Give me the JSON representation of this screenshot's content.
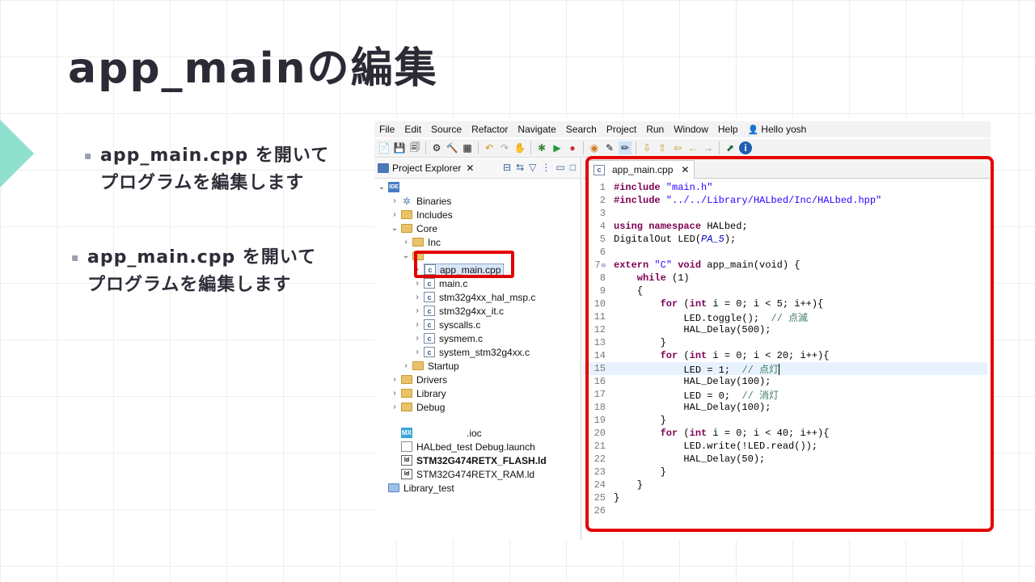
{
  "slide": {
    "title": "app_mainの編集",
    "bullets": [
      {
        "line1": "app_main.cpp を開いて",
        "line2": "プログラムを編集します"
      },
      {
        "line1": "app_main.cpp を開いて",
        "line2": "プログラムを編集します"
      }
    ],
    "accent_color": "#8fe0cc",
    "highlight_color": "#e30000"
  },
  "ide": {
    "menu": [
      "File",
      "Edit",
      "Source",
      "Refactor",
      "Navigate",
      "Search",
      "Project",
      "Run",
      "Window",
      "Help"
    ],
    "user": "Hello yosh",
    "explorer": {
      "title": "Project Explorer",
      "close": "✕",
      "tree": [
        {
          "label": "",
          "icon": "project-icon",
          "expanded": true
        },
        {
          "label": "Binaries",
          "icon": "binaries-icon"
        },
        {
          "label": "Includes",
          "icon": "includes-icon"
        },
        {
          "label": "Core",
          "icon": "folder-icon",
          "expanded": true
        },
        {
          "label": "Inc",
          "icon": "folder-icon"
        },
        {
          "label": "",
          "icon": "folder-icon",
          "expanded": true
        },
        {
          "label": "app_main.cpp",
          "icon": "c-file-icon",
          "selected": true
        },
        {
          "label": "main.c",
          "icon": "c-file-icon"
        },
        {
          "label": "stm32g4xx_hal_msp.c",
          "icon": "c-file-icon"
        },
        {
          "label": "stm32g4xx_it.c",
          "icon": "c-file-icon"
        },
        {
          "label": "syscalls.c",
          "icon": "c-file-icon"
        },
        {
          "label": "sysmem.c",
          "icon": "c-file-icon"
        },
        {
          "label": "system_stm32g4xx.c",
          "icon": "c-file-icon"
        },
        {
          "label": "Startup",
          "icon": "folder-icon"
        },
        {
          "label": "Drivers",
          "icon": "folder-icon"
        },
        {
          "label": "Library",
          "icon": "folder-icon"
        },
        {
          "label": "Debug",
          "icon": "folder-icon"
        },
        {
          "label": ".ioc",
          "icon": "mx-icon"
        },
        {
          "label": "HALbed_test Debug.launch",
          "icon": "launch-file-icon"
        },
        {
          "label": "STM32G474RETX_FLASH.ld",
          "icon": "linker-file-icon",
          "bold": true
        },
        {
          "label": "STM32G474RETX_RAM.ld",
          "icon": "linker-file-icon"
        },
        {
          "label": "Library_test",
          "icon": "project-folder-icon"
        }
      ]
    },
    "editor": {
      "tab": "app_main.cpp",
      "tab_close": "✕",
      "lines": [
        "1",
        "2",
        "3",
        "4",
        "5",
        "6",
        "7",
        "8",
        "9",
        "10",
        "11",
        "12",
        "13",
        "14",
        "15",
        "16",
        "17",
        "18",
        "19",
        "20",
        "21",
        "22",
        "23",
        "24",
        "25",
        "26"
      ],
      "code": {
        "l1": {
          "a": "#include",
          "b": " \"main.h\""
        },
        "l2": {
          "a": "#include",
          "b": " \"../../Library/HALbed/Inc/HALbed.hpp\""
        },
        "l4": {
          "a": "using namespace",
          "b": " HALbed;"
        },
        "l5": {
          "a": "DigitalOut LED(",
          "b": "PA_5",
          "c": ");"
        },
        "l7": {
          "a": "extern",
          "b": " \"C\"",
          "c": " void",
          "d": " app_main(void) {"
        },
        "l8": {
          "a": "    while",
          "b": " (1)"
        },
        "l9": "    {",
        "l10": {
          "a": "        for",
          "b": " (",
          "c": "int",
          "d": " i = 0; i < 5; i++){"
        },
        "l11": {
          "a": "            LED.toggle();  ",
          "b": "// 点滅"
        },
        "l12": "            HAL_Delay(500);",
        "l13": "        }",
        "l14": {
          "a": "        for",
          "b": " (",
          "c": "int",
          "d": " i = 0; i < 20; i++){"
        },
        "l15": {
          "a": "            LED = 1;  ",
          "b": "// 点灯"
        },
        "l16": "            HAL_Delay(100);",
        "l17": {
          "a": "            LED = 0;  ",
          "b": "// 消灯"
        },
        "l18": "            HAL_Delay(100);",
        "l19": "        }",
        "l20": {
          "a": "        for",
          "b": " (",
          "c": "int",
          "d": " i = 0; i < 40; i++){"
        },
        "l21": "            LED.write(!LED.read());",
        "l22": "            HAL_Delay(50);",
        "l23": "        }",
        "l24": "    }",
        "l25": "}"
      }
    }
  }
}
